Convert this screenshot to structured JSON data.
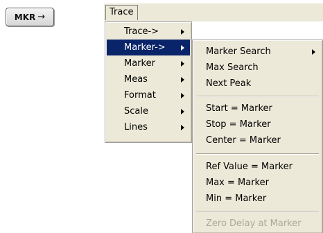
{
  "mkr_button": {
    "label": "MKR",
    "arrow": "→"
  },
  "menubar": {
    "items": [
      "Trace"
    ]
  },
  "trace_menu": {
    "items": [
      {
        "label": "Trace->",
        "has_submenu": true
      },
      {
        "label": "Marker->",
        "has_submenu": true,
        "highlighted": true
      },
      {
        "label": "Marker",
        "has_submenu": true
      },
      {
        "label": "Meas",
        "has_submenu": true
      },
      {
        "label": "Format",
        "has_submenu": true
      },
      {
        "label": "Scale",
        "has_submenu": true
      },
      {
        "label": "Lines",
        "has_submenu": true
      }
    ]
  },
  "marker_submenu": {
    "groups": [
      [
        {
          "label": "Marker Search",
          "has_submenu": true
        },
        {
          "label": "Max Search"
        },
        {
          "label": "Next Peak"
        }
      ],
      [
        {
          "label": "Start = Marker"
        },
        {
          "label": "Stop = Marker"
        },
        {
          "label": "Center = Marker"
        }
      ],
      [
        {
          "label": "Ref Value = Marker"
        },
        {
          "label": "Max = Marker"
        },
        {
          "label": "Min = Marker"
        }
      ],
      [
        {
          "label": "Zero Delay at Marker",
          "disabled": true
        }
      ]
    ]
  },
  "colors": {
    "menu_background": "#ece9d8",
    "highlight": "#0a246a",
    "disabled_text": "#aca899"
  }
}
